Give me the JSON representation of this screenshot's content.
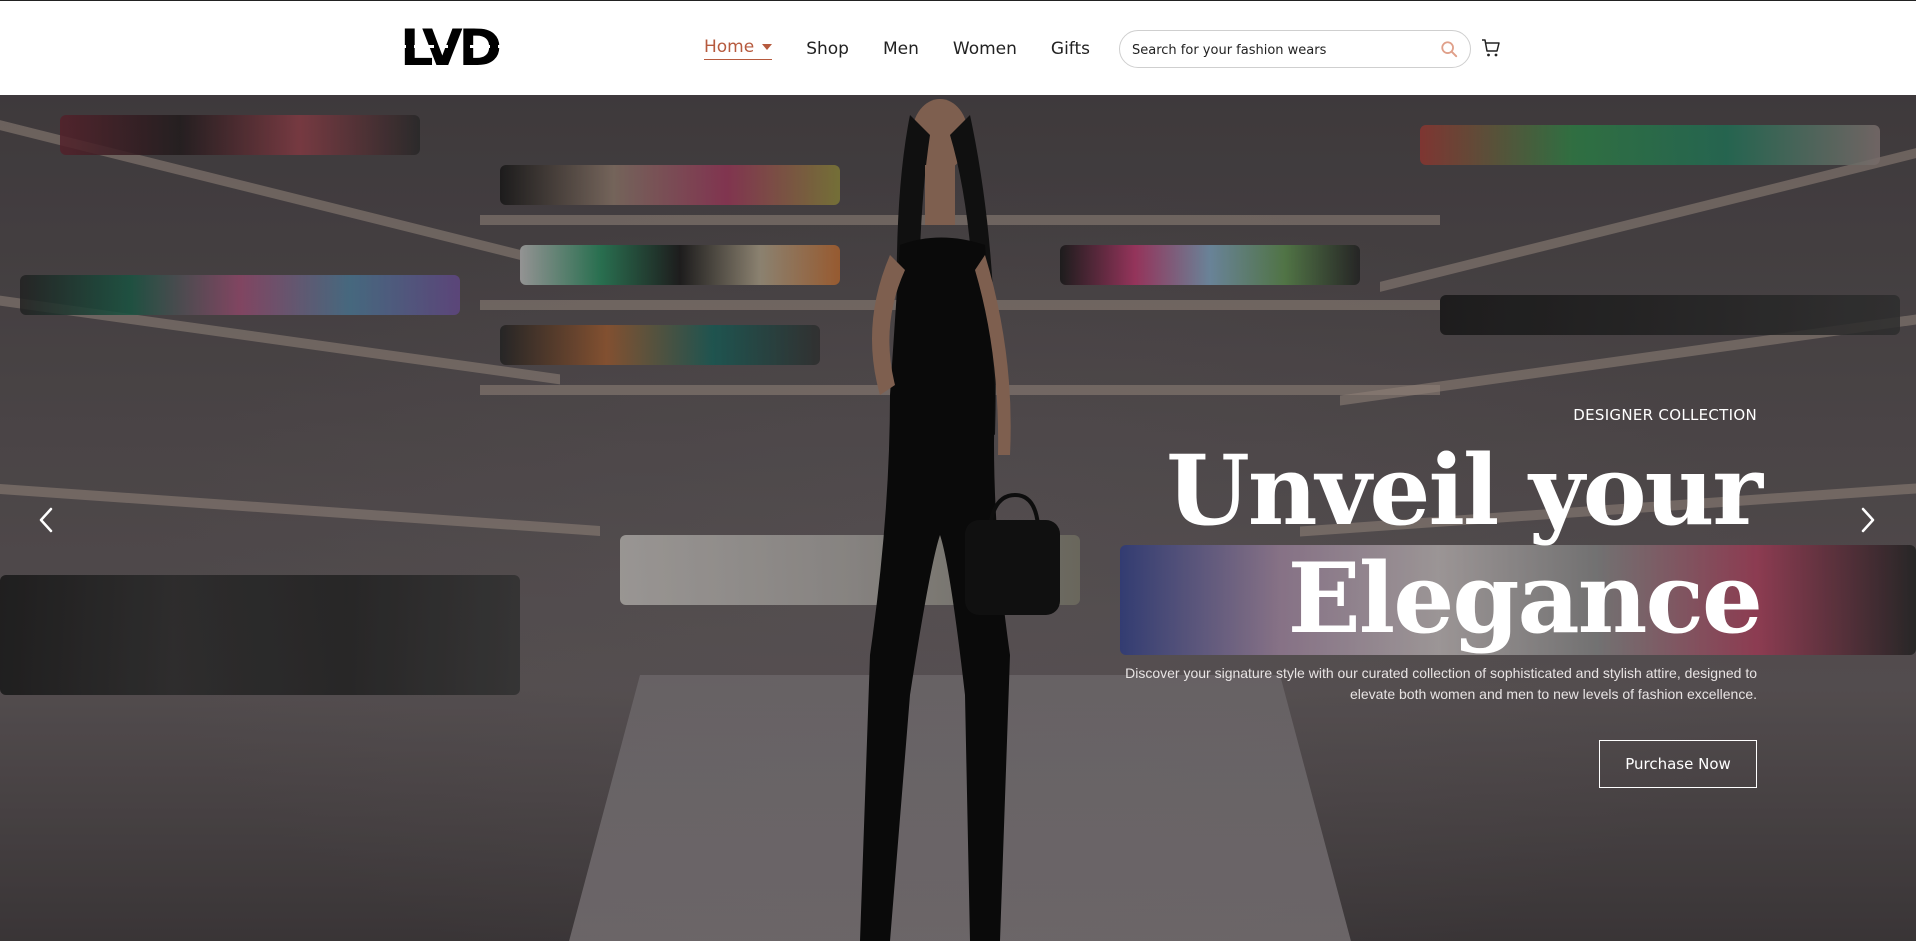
{
  "brand": {
    "logo_text": "LVD"
  },
  "nav": {
    "items": [
      {
        "label": "Home",
        "active": true
      },
      {
        "label": "Shop"
      },
      {
        "label": "Men"
      },
      {
        "label": "Women"
      },
      {
        "label": "Gifts"
      }
    ]
  },
  "search": {
    "placeholder": "Search for your fashion wears",
    "icon": "search-icon",
    "icon_color": "#e0a08a"
  },
  "cart": {
    "icon": "cart-icon"
  },
  "hero": {
    "eyebrow": "DESIGNER COLLECTION",
    "headline_line1": "Unveil your",
    "headline_line2": "Elegance",
    "description": "Discover your signature style with our curated collection of sophisticated and stylish attire, designed to elevate both women and men to new levels of fashion excellence.",
    "cta_label": "Purchase Now",
    "prev_icon": "chevron-left-icon",
    "next_icon": "chevron-right-icon"
  },
  "colors": {
    "accent": "#b65a3e",
    "text": "#222222",
    "hero_text": "#ffffff"
  }
}
